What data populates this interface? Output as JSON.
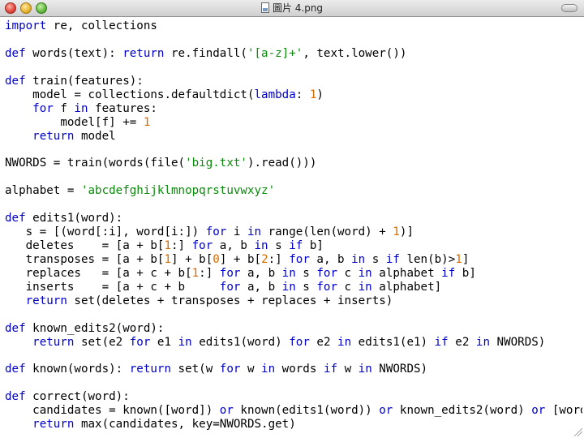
{
  "window": {
    "title": "圖片 4.png",
    "title_icon": "file-icon"
  },
  "colors": {
    "keyword": "#0000c8",
    "string": "#0a8a0a",
    "number": "#d76b00",
    "text": "#000000"
  },
  "code": {
    "lines": [
      [
        {
          "t": "import",
          "k": "keyword"
        },
        {
          "t": " re, collections"
        }
      ],
      [],
      [
        {
          "t": "def",
          "k": "keyword"
        },
        {
          "t": " words(text): "
        },
        {
          "t": "return",
          "k": "keyword"
        },
        {
          "t": " re.findall("
        },
        {
          "t": "'[a-z]+'",
          "k": "string"
        },
        {
          "t": ", text.lower())"
        }
      ],
      [],
      [
        {
          "t": "def",
          "k": "keyword"
        },
        {
          "t": " train(features):"
        }
      ],
      [
        {
          "t": "    model = collections.defaultdict("
        },
        {
          "t": "lambda",
          "k": "keyword"
        },
        {
          "t": ": "
        },
        {
          "t": "1",
          "k": "number"
        },
        {
          "t": ")"
        }
      ],
      [
        {
          "t": "    "
        },
        {
          "t": "for",
          "k": "keyword"
        },
        {
          "t": " f "
        },
        {
          "t": "in",
          "k": "keyword"
        },
        {
          "t": " features:"
        }
      ],
      [
        {
          "t": "        model[f] += "
        },
        {
          "t": "1",
          "k": "number"
        }
      ],
      [
        {
          "t": "    "
        },
        {
          "t": "return",
          "k": "keyword"
        },
        {
          "t": " model"
        }
      ],
      [],
      [
        {
          "t": "NWORDS = train(words(file("
        },
        {
          "t": "'big.txt'",
          "k": "string"
        },
        {
          "t": ").read()))"
        }
      ],
      [],
      [
        {
          "t": "alphabet = "
        },
        {
          "t": "'abcdefghijklmnopqrstuvwxyz'",
          "k": "string"
        }
      ],
      [],
      [
        {
          "t": "def",
          "k": "keyword"
        },
        {
          "t": " edits1(word):"
        }
      ],
      [
        {
          "t": "   s = [(word[:i], word[i:]) "
        },
        {
          "t": "for",
          "k": "keyword"
        },
        {
          "t": " i "
        },
        {
          "t": "in",
          "k": "keyword"
        },
        {
          "t": " range(len(word) + "
        },
        {
          "t": "1",
          "k": "number"
        },
        {
          "t": ")]"
        }
      ],
      [
        {
          "t": "   deletes    = [a + b["
        },
        {
          "t": "1",
          "k": "number"
        },
        {
          "t": ":] "
        },
        {
          "t": "for",
          "k": "keyword"
        },
        {
          "t": " a, b "
        },
        {
          "t": "in",
          "k": "keyword"
        },
        {
          "t": " s "
        },
        {
          "t": "if",
          "k": "keyword"
        },
        {
          "t": " b]"
        }
      ],
      [
        {
          "t": "   transposes = [a + b["
        },
        {
          "t": "1",
          "k": "number"
        },
        {
          "t": "] + b["
        },
        {
          "t": "0",
          "k": "number"
        },
        {
          "t": "] + b["
        },
        {
          "t": "2",
          "k": "number"
        },
        {
          "t": ":] "
        },
        {
          "t": "for",
          "k": "keyword"
        },
        {
          "t": " a, b "
        },
        {
          "t": "in",
          "k": "keyword"
        },
        {
          "t": " s "
        },
        {
          "t": "if",
          "k": "keyword"
        },
        {
          "t": " len(b)>"
        },
        {
          "t": "1",
          "k": "number"
        },
        {
          "t": "]"
        }
      ],
      [
        {
          "t": "   replaces   = [a + c + b["
        },
        {
          "t": "1",
          "k": "number"
        },
        {
          "t": ":] "
        },
        {
          "t": "for",
          "k": "keyword"
        },
        {
          "t": " a, b "
        },
        {
          "t": "in",
          "k": "keyword"
        },
        {
          "t": " s "
        },
        {
          "t": "for",
          "k": "keyword"
        },
        {
          "t": " c "
        },
        {
          "t": "in",
          "k": "keyword"
        },
        {
          "t": " alphabet "
        },
        {
          "t": "if",
          "k": "keyword"
        },
        {
          "t": " b]"
        }
      ],
      [
        {
          "t": "   inserts    = [a + c + b     "
        },
        {
          "t": "for",
          "k": "keyword"
        },
        {
          "t": " a, b "
        },
        {
          "t": "in",
          "k": "keyword"
        },
        {
          "t": " s "
        },
        {
          "t": "for",
          "k": "keyword"
        },
        {
          "t": " c "
        },
        {
          "t": "in",
          "k": "keyword"
        },
        {
          "t": " alphabet]"
        }
      ],
      [
        {
          "t": "   "
        },
        {
          "t": "return",
          "k": "keyword"
        },
        {
          "t": " set(deletes + transposes + replaces + inserts)"
        }
      ],
      [],
      [
        {
          "t": "def",
          "k": "keyword"
        },
        {
          "t": " known_edits2(word):"
        }
      ],
      [
        {
          "t": "    "
        },
        {
          "t": "return",
          "k": "keyword"
        },
        {
          "t": " set(e2 "
        },
        {
          "t": "for",
          "k": "keyword"
        },
        {
          "t": " e1 "
        },
        {
          "t": "in",
          "k": "keyword"
        },
        {
          "t": " edits1(word) "
        },
        {
          "t": "for",
          "k": "keyword"
        },
        {
          "t": " e2 "
        },
        {
          "t": "in",
          "k": "keyword"
        },
        {
          "t": " edits1(e1) "
        },
        {
          "t": "if",
          "k": "keyword"
        },
        {
          "t": " e2 "
        },
        {
          "t": "in",
          "k": "keyword"
        },
        {
          "t": " NWORDS)"
        }
      ],
      [],
      [
        {
          "t": "def",
          "k": "keyword"
        },
        {
          "t": " known(words): "
        },
        {
          "t": "return",
          "k": "keyword"
        },
        {
          "t": " set(w "
        },
        {
          "t": "for",
          "k": "keyword"
        },
        {
          "t": " w "
        },
        {
          "t": "in",
          "k": "keyword"
        },
        {
          "t": " words "
        },
        {
          "t": "if",
          "k": "keyword"
        },
        {
          "t": " w "
        },
        {
          "t": "in",
          "k": "keyword"
        },
        {
          "t": " NWORDS)"
        }
      ],
      [],
      [
        {
          "t": "def",
          "k": "keyword"
        },
        {
          "t": " correct(word):"
        }
      ],
      [
        {
          "t": "    candidates = known([word]) "
        },
        {
          "t": "or",
          "k": "keyword"
        },
        {
          "t": " known(edits1(word)) "
        },
        {
          "t": "or",
          "k": "keyword"
        },
        {
          "t": " known_edits2(word) "
        },
        {
          "t": "or",
          "k": "keyword"
        },
        {
          "t": " [word]"
        }
      ],
      [
        {
          "t": "    "
        },
        {
          "t": "return",
          "k": "keyword"
        },
        {
          "t": " max(candidates, key=NWORDS.get)"
        }
      ]
    ]
  }
}
